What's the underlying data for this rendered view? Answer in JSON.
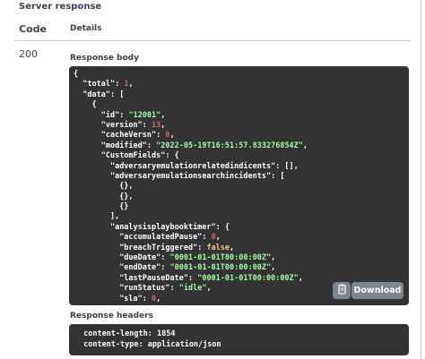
{
  "section_title": "Server response",
  "columns": {
    "code": "Code",
    "details": "Details"
  },
  "response": {
    "status_code": "200",
    "body_label": "Response body",
    "download_label": "Download",
    "copy_icon": "clipboard-icon",
    "body_lines": [
      [
        [
          "{",
          "p"
        ]
      ],
      [
        [
          "  ",
          "p"
        ],
        [
          "\"total\"",
          "k"
        ],
        [
          ": ",
          "p"
        ],
        [
          "1",
          "n"
        ],
        [
          ",",
          "p"
        ]
      ],
      [
        [
          "  ",
          "p"
        ],
        [
          "\"data\"",
          "k"
        ],
        [
          ": [",
          "p"
        ]
      ],
      [
        [
          "    {",
          "p"
        ]
      ],
      [
        [
          "      ",
          "p"
        ],
        [
          "\"id\"",
          "k"
        ],
        [
          ": ",
          "p"
        ],
        [
          "\"12001\"",
          "s"
        ],
        [
          ",",
          "p"
        ]
      ],
      [
        [
          "      ",
          "p"
        ],
        [
          "\"version\"",
          "k"
        ],
        [
          ": ",
          "p"
        ],
        [
          "13",
          "n"
        ],
        [
          ",",
          "p"
        ]
      ],
      [
        [
          "      ",
          "p"
        ],
        [
          "\"cacheVersn\"",
          "k"
        ],
        [
          ": ",
          "p"
        ],
        [
          "0",
          "n"
        ],
        [
          ",",
          "p"
        ]
      ],
      [
        [
          "      ",
          "p"
        ],
        [
          "\"modified\"",
          "k"
        ],
        [
          ": ",
          "p"
        ],
        [
          "\"2022-05-19T16:51:57.833276854Z\"",
          "s"
        ],
        [
          ",",
          "p"
        ]
      ],
      [
        [
          "      ",
          "p"
        ],
        [
          "\"CustomFields\"",
          "k"
        ],
        [
          ": {",
          "p"
        ]
      ],
      [
        [
          "        ",
          "p"
        ],
        [
          "\"adversaryemulationrelatedindicents\"",
          "k"
        ],
        [
          ": [],",
          "p"
        ]
      ],
      [
        [
          "        ",
          "p"
        ],
        [
          "\"adversaryemulationsearchincidents\"",
          "k"
        ],
        [
          ": [",
          "p"
        ]
      ],
      [
        [
          "          {},",
          "p"
        ]
      ],
      [
        [
          "          {},",
          "p"
        ]
      ],
      [
        [
          "          {}",
          "p"
        ]
      ],
      [
        [
          "        ],",
          "p"
        ]
      ],
      [
        [
          "        ",
          "p"
        ],
        [
          "\"analysisplaybooktimer\"",
          "k"
        ],
        [
          ": {",
          "p"
        ]
      ],
      [
        [
          "          ",
          "p"
        ],
        [
          "\"accumulatedPause\"",
          "k"
        ],
        [
          ": ",
          "p"
        ],
        [
          "0",
          "n"
        ],
        [
          ",",
          "p"
        ]
      ],
      [
        [
          "          ",
          "p"
        ],
        [
          "\"breachTriggered\"",
          "k"
        ],
        [
          ": ",
          "p"
        ],
        [
          "false",
          "b"
        ],
        [
          ",",
          "p"
        ]
      ],
      [
        [
          "          ",
          "p"
        ],
        [
          "\"dueDate\"",
          "k"
        ],
        [
          ": ",
          "p"
        ],
        [
          "\"0001-01-01T00:00:00Z\"",
          "s"
        ],
        [
          ",",
          "p"
        ]
      ],
      [
        [
          "          ",
          "p"
        ],
        [
          "\"endDate\"",
          "k"
        ],
        [
          ": ",
          "p"
        ],
        [
          "\"0001-01-01T00:00:00Z\"",
          "s"
        ],
        [
          ",",
          "p"
        ]
      ],
      [
        [
          "          ",
          "p"
        ],
        [
          "\"lastPauseDate\"",
          "k"
        ],
        [
          ": ",
          "p"
        ],
        [
          "\"0001-01-01T00:00:00Z\"",
          "s"
        ],
        [
          ",",
          "p"
        ]
      ],
      [
        [
          "          ",
          "p"
        ],
        [
          "\"runStatus\"",
          "k"
        ],
        [
          ": ",
          "p"
        ],
        [
          "\"idle\"",
          "s"
        ],
        [
          ",",
          "p"
        ]
      ],
      [
        [
          "          ",
          "p"
        ],
        [
          "\"sla\"",
          "k"
        ],
        [
          ": ",
          "p"
        ],
        [
          "0",
          "n"
        ],
        [
          ",",
          "p"
        ]
      ]
    ],
    "headers_label": "Response headers",
    "headers_lines": [
      " content-length: 1854 ",
      " content-type: application/json "
    ]
  },
  "colors": {
    "code_background": "#333333",
    "string": "#a2fca2",
    "number": "#d36363",
    "boolean": "#fcc28c",
    "button": "#7d8492"
  }
}
